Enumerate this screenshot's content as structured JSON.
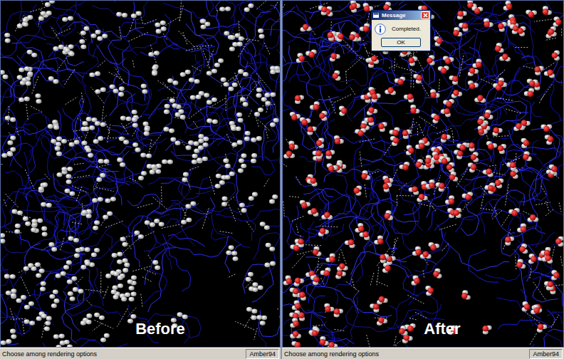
{
  "panels": [
    {
      "label": "Before",
      "oxygen_shown": false,
      "status": {
        "text": "Choose among rendering options",
        "force_field": "Amber94"
      }
    },
    {
      "label": "After",
      "oxygen_shown": true,
      "status": {
        "text": "Choose among rendering options",
        "force_field": "Amber94"
      }
    }
  ],
  "dialog": {
    "title": "Message",
    "message": "Completed.",
    "buttons": [
      "OK"
    ]
  }
}
